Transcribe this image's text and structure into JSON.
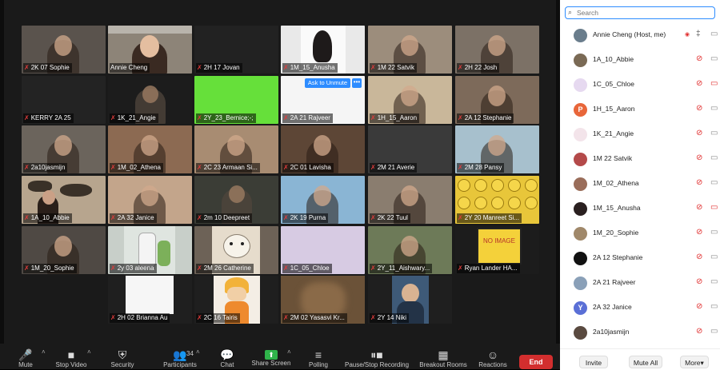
{
  "gallery": {
    "tiles": [
      {
        "label": "2K 07 Sophie",
        "bg": "#5a534d",
        "art": "person",
        "muted": true
      },
      {
        "label": "Annie Cheng",
        "bg": "#8d8478",
        "art": "person-light",
        "muted": false
      },
      {
        "label": "2H 17 Jovan",
        "bg": "#222222",
        "art": "none",
        "muted": true
      },
      {
        "label": "1M_15_Anusha",
        "bg": "#e9e9e9",
        "art": "drawing",
        "muted": true
      },
      {
        "label": "1M 22 Satvik",
        "bg": "#9c8d7c",
        "art": "person",
        "muted": true
      },
      {
        "label": "2H 22 Josh",
        "bg": "#7c7166",
        "art": "person",
        "muted": true
      },
      {
        "label": "KERRY 2A 25",
        "bg": "#232323",
        "art": "none",
        "muted": true
      },
      {
        "label": "1K_21_Angie",
        "bg": "#1c1c1c",
        "art": "person-dark",
        "muted": true
      },
      {
        "label": "2Y_23_Bernice;-;",
        "bg": "#66e03a",
        "art": "none",
        "muted": true
      },
      {
        "label": "2A 21 Rajveer",
        "bg": "#f5f5f5",
        "art": "none",
        "muted": true
      },
      {
        "label": "1H_15_Aaron",
        "bg": "#c9b79a",
        "art": "person",
        "muted": true
      },
      {
        "label": "2A 12 Stephanie",
        "bg": "#7d6a5a",
        "art": "person",
        "muted": true
      },
      {
        "label": "2a10jasmijn",
        "bg": "#6b645c",
        "art": "person",
        "muted": true
      },
      {
        "label": "1M_02_Athena",
        "bg": "#8c6a52",
        "art": "person",
        "muted": true
      },
      {
        "label": "2C 23 Armaan Si...",
        "bg": "#a88c72",
        "art": "person",
        "muted": true
      },
      {
        "label": "2C 01 Lavisha",
        "bg": "#5d4636",
        "art": "person",
        "muted": true
      },
      {
        "label": "2M 21 Averie",
        "bg": "#3a3a3a",
        "art": "none",
        "muted": true
      },
      {
        "label": "2M 28 Pansy",
        "bg": "#a7c0cd",
        "art": "person",
        "muted": true
      },
      {
        "label": "1A_10_Abbie",
        "bg": "#b7a58e",
        "art": "map",
        "muted": true
      },
      {
        "label": "2A 32 Janice",
        "bg": "#c3a58b",
        "art": "person",
        "muted": true
      },
      {
        "label": "2m 10 Deepreet",
        "bg": "#3b3d36",
        "art": "person-dark",
        "muted": true
      },
      {
        "label": "2K 19 Purna",
        "bg": "#8ab5d4",
        "art": "person",
        "muted": true
      },
      {
        "label": "2K 22 Tuul",
        "bg": "#8a7d6f",
        "art": "person",
        "muted": true
      },
      {
        "label": "2Y 20 Manreet Si...",
        "bg": "#e8c63a",
        "art": "emoji",
        "muted": true
      },
      {
        "label": "1M_20_Sophie",
        "bg": "#4f4944",
        "art": "person",
        "muted": true
      },
      {
        "label": "2y 03 aleena",
        "bg": "#c8cfc9",
        "art": "bottle",
        "muted": true
      },
      {
        "label": "2M 26 Catherine",
        "bg": "#6d6257",
        "art": "bear",
        "muted": true
      },
      {
        "label": "1C_05_Chloe",
        "bg": "#d7cbe3",
        "art": "none",
        "muted": true
      },
      {
        "label": "2Y_11_Aishwary...",
        "bg": "#6d7a58",
        "art": "person",
        "muted": true
      },
      {
        "label": "Ryan Lander HA...",
        "bg": "#1c1c1c",
        "art": "noimage",
        "muted": true
      },
      {
        "label": "2H 02 Brianna Au",
        "bg": "#1f1f1f",
        "art": "whitebox",
        "muted": true
      },
      {
        "label": "2C 16 Tairis",
        "bg": "#1f1f1f",
        "art": "naruto",
        "muted": true
      },
      {
        "label": "2M 02 Yasasvi Kr...",
        "bg": "#6b5238",
        "art": "blur",
        "muted": true
      },
      {
        "label": "2Y 14 Niki",
        "bg": "#1f1f1f",
        "art": "person-photo",
        "muted": true
      }
    ],
    "hover": {
      "unmute_label": "Ask to Unmute",
      "more_label": "•••"
    },
    "noimage_text": "NO IMAGE"
  },
  "toolbar": {
    "items": [
      {
        "label": "Mute",
        "icon": "🎤",
        "name": "mute"
      },
      {
        "label": "Stop Video",
        "icon": "■",
        "name": "stop-video"
      },
      {
        "label": "Security",
        "icon": "⛨",
        "name": "security"
      },
      {
        "label": "Participants",
        "icon": "👥",
        "name": "participants"
      },
      {
        "label": "Chat",
        "icon": "💬",
        "name": "chat"
      },
      {
        "label": "Share Screen",
        "icon": "⬆",
        "name": "share-screen"
      },
      {
        "label": "Polling",
        "icon": "≡",
        "name": "polling"
      },
      {
        "label": "Pause/Stop Recording",
        "icon": "⏸■",
        "name": "recording"
      },
      {
        "label": "Breakout Rooms",
        "icon": "▦",
        "name": "breakout-rooms"
      },
      {
        "label": "Reactions",
        "icon": "☺",
        "name": "reactions"
      }
    ],
    "participants_count": "34",
    "end_label": "End",
    "share_color": "#2fb34a",
    "end_color": "#d22e2e"
  },
  "panel": {
    "search_placeholder": "Search",
    "participants": [
      {
        "name": "Annie Cheng (Host, me)",
        "initial": "",
        "color": "#6a7d8c",
        "recording": true,
        "mic_on": true,
        "cam_off": false
      },
      {
        "name": "1A_10_Abbie",
        "initial": "",
        "color": "#7a6a55",
        "recording": false,
        "mic_on": false,
        "cam_off": false
      },
      {
        "name": "1C_05_Chloe",
        "initial": "",
        "color": "#e6d9f0",
        "recording": false,
        "mic_on": false,
        "cam_off": true
      },
      {
        "name": "1H_15_Aaron",
        "initial": "P",
        "color": "#e8663a",
        "recording": false,
        "mic_on": false,
        "cam_off": false
      },
      {
        "name": "1K_21_Angie",
        "initial": "",
        "color": "#f3e4ea",
        "recording": false,
        "mic_on": false,
        "cam_off": false
      },
      {
        "name": "1M 22 Satvik",
        "initial": "",
        "color": "#b44a4a",
        "recording": false,
        "mic_on": false,
        "cam_off": false
      },
      {
        "name": "1M_02_Athena",
        "initial": "",
        "color": "#9a6d5a",
        "recording": false,
        "mic_on": false,
        "cam_off": false
      },
      {
        "name": "1M_15_Anusha",
        "initial": "",
        "color": "#2a2020",
        "recording": false,
        "mic_on": false,
        "cam_off": true
      },
      {
        "name": "1M_20_Sophie",
        "initial": "",
        "color": "#a0886a",
        "recording": false,
        "mic_on": false,
        "cam_off": false
      },
      {
        "name": "2A 12 Stephanie",
        "initial": "",
        "color": "#111111",
        "recording": false,
        "mic_on": false,
        "cam_off": false
      },
      {
        "name": "2A 21 Rajveer",
        "initial": "",
        "color": "#8aa0b8",
        "recording": false,
        "mic_on": false,
        "cam_off": false
      },
      {
        "name": "2A 32 Janice",
        "initial": "Y",
        "color": "#5a6fd6",
        "recording": false,
        "mic_on": false,
        "cam_off": false
      },
      {
        "name": "2a10jasmijn",
        "initial": "",
        "color": "#5a4a40",
        "recording": false,
        "mic_on": false,
        "cam_off": false
      }
    ],
    "footer": {
      "invite": "Invite",
      "mute_all": "Mute All",
      "more": "More▾"
    }
  }
}
